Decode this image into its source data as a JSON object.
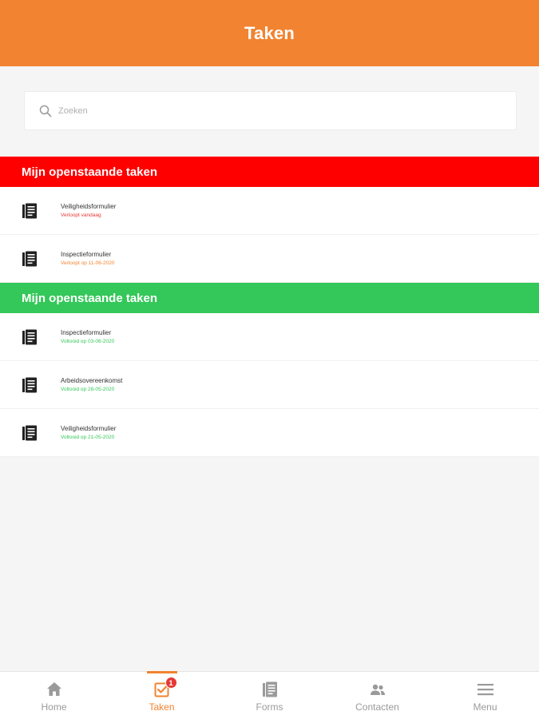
{
  "header": {
    "title": "Taken"
  },
  "search": {
    "placeholder": "Zoeken"
  },
  "sections": [
    {
      "title": "Mijn openstaande taken",
      "color": "#ff0000",
      "tasks": [
        {
          "name": "Veiligheidsformulier",
          "sub": "Verloopt vandaag",
          "status_color": "#e53935",
          "icon": "form-document-icon"
        },
        {
          "name": "Inspectieformulier",
          "sub": "Verloopt op 11-06-2020",
          "status_color": "#f28330",
          "icon": "form-document-icon"
        }
      ]
    },
    {
      "title": "Mijn openstaande taken",
      "color": "#34c759",
      "tasks": [
        {
          "name": "Inspectieformulier",
          "sub": "Voltooid op 03-06-2020",
          "status_color": "#34c759",
          "icon": "form-document-icon"
        },
        {
          "name": "Arbeidsovereenkomst",
          "sub": "Voltooid op 28-05-2020",
          "status_color": "#34c759",
          "icon": "form-document-icon"
        },
        {
          "name": "Veiligheidsformulier",
          "sub": "Voltooid op 21-05-2020",
          "status_color": "#34c759",
          "icon": "form-document-icon"
        }
      ]
    }
  ],
  "tabbar": {
    "items": [
      {
        "label": "Home",
        "icon": "home-icon",
        "active": false
      },
      {
        "label": "Taken",
        "icon": "tasks-icon",
        "active": true,
        "badge": "1"
      },
      {
        "label": "Forms",
        "icon": "forms-icon",
        "active": false
      },
      {
        "label": "Contacten",
        "icon": "contacts-icon",
        "active": false
      },
      {
        "label": "Menu",
        "icon": "menu-icon",
        "active": false
      }
    ]
  },
  "colors": {
    "accent": "#f28330",
    "danger": "#ff0000",
    "success": "#34c759",
    "background": "#f5f5f5"
  }
}
